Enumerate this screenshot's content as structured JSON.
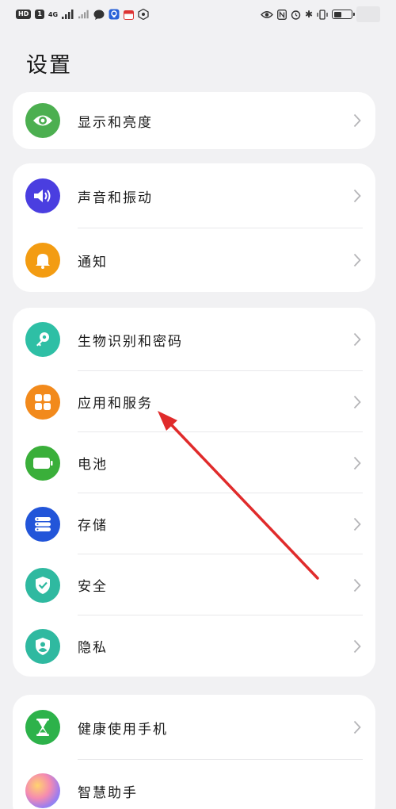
{
  "status_bar": {
    "left_badges": [
      "HD",
      "1"
    ],
    "network": "4G"
  },
  "page": {
    "title": "设置"
  },
  "cards": [
    {
      "items": [
        {
          "label": "显示和亮度",
          "icon": "eye-icon",
          "color": "#4caf50"
        }
      ]
    },
    {
      "items": [
        {
          "label": "声音和振动",
          "icon": "speaker-icon",
          "color": "#4a3ee0"
        },
        {
          "label": "通知",
          "icon": "bell-icon",
          "color": "#f39c12"
        }
      ]
    },
    {
      "items": [
        {
          "label": "生物识别和密码",
          "icon": "key-icon",
          "color": "#2ebfa5"
        },
        {
          "label": "应用和服务",
          "icon": "apps-grid-icon",
          "color": "#f28a1c"
        },
        {
          "label": "电池",
          "icon": "battery-icon",
          "color": "#3aaf3a"
        },
        {
          "label": "存储",
          "icon": "storage-icon",
          "color": "#2255d9"
        },
        {
          "label": "安全",
          "icon": "shield-check-icon",
          "color": "#2fb9a0"
        },
        {
          "label": "隐私",
          "icon": "privacy-shield-icon",
          "color": "#2fb9a0"
        }
      ]
    },
    {
      "items": [
        {
          "label": "健康使用手机",
          "icon": "hourglass-icon",
          "color": "#2db24a"
        },
        {
          "label": "智慧助手",
          "icon": "assistant-orb-icon",
          "color": "#c27ad8"
        }
      ]
    }
  ],
  "annotation": {
    "color": "#e02b2b"
  }
}
